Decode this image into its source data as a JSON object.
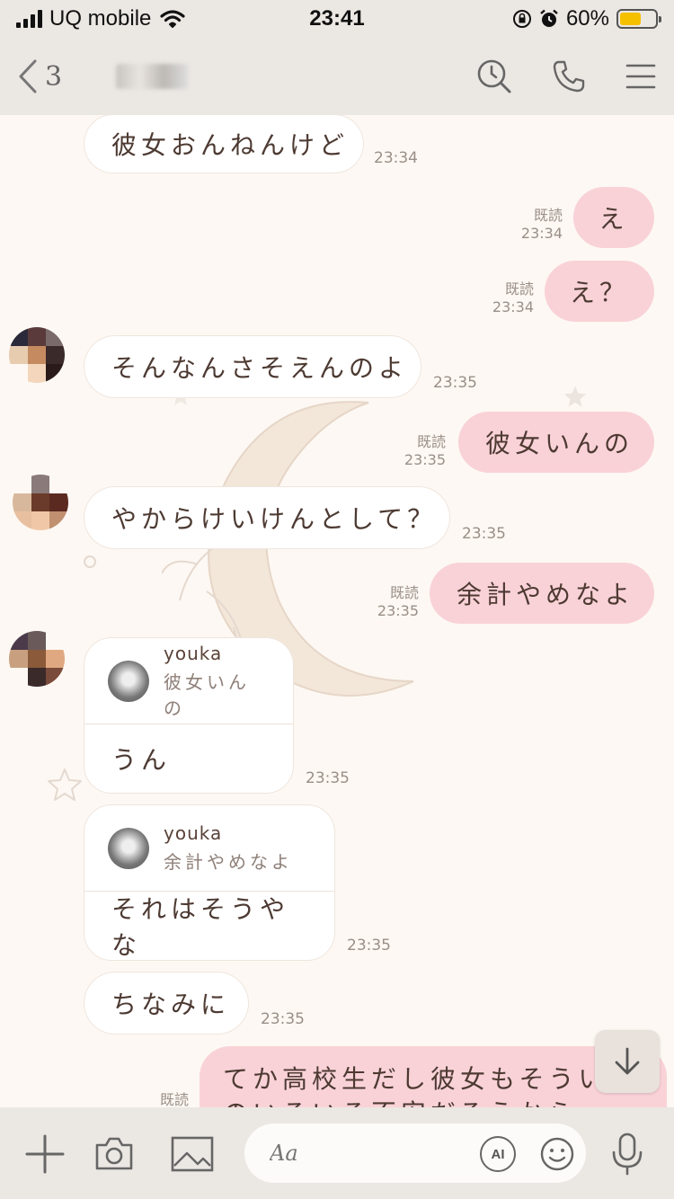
{
  "status_bar": {
    "carrier": "UQ mobile",
    "time": "23:41",
    "battery": "60%",
    "battery_level": 0.6
  },
  "header": {
    "back_count": "3"
  },
  "messages": [
    {
      "id": "m1",
      "dir": "in",
      "text": "彼女おんねんけど",
      "time": "23:34"
    },
    {
      "id": "m2",
      "dir": "out",
      "text": "え",
      "read": "既読",
      "time": "23:34"
    },
    {
      "id": "m3",
      "dir": "out",
      "text": "え？",
      "read": "既読",
      "time": "23:34"
    },
    {
      "id": "m4",
      "dir": "in",
      "text": "そんなんさそえんのよ",
      "time": "23:35"
    },
    {
      "id": "m5",
      "dir": "out",
      "text": "彼女いんの",
      "read": "既読",
      "time": "23:35"
    },
    {
      "id": "m6",
      "dir": "in",
      "text": "やからけいけんとして？",
      "time": "23:35"
    },
    {
      "id": "m7",
      "dir": "out",
      "text": "余計やめなよ",
      "read": "既読",
      "time": "23:35"
    },
    {
      "id": "m8",
      "dir": "in",
      "reply_user": "youka",
      "reply_quote": "彼女いんの",
      "text": "うん",
      "time": "23:35"
    },
    {
      "id": "m9",
      "dir": "in",
      "reply_user": "youka",
      "reply_quote": "余計やめなよ",
      "text": "それはそうやな",
      "time": "23:35"
    },
    {
      "id": "m10",
      "dir": "in",
      "text": "ちなみに",
      "time": "23:35"
    },
    {
      "id": "m11",
      "dir": "out",
      "text": "てか高校生だし彼女もそうい",
      "text_line2": "のいろいろ不安だろうから",
      "read": "既読"
    }
  ],
  "input": {
    "placeholder": "Aa",
    "ai_label": "AI"
  },
  "colors": {
    "bar_bg": "#ebe7e3",
    "chat_bg": "#fdf8f3",
    "bubble_out": "#f9d2d8",
    "bubble_in": "#ffffff",
    "text": "#4d3a32"
  },
  "icons": [
    "back-chevron-icon",
    "search-clock-icon",
    "phone-icon",
    "menu-icon",
    "plus-icon",
    "camera-icon",
    "image-icon",
    "ai-icon",
    "emoji-icon",
    "microphone-icon",
    "arrow-down-icon"
  ]
}
